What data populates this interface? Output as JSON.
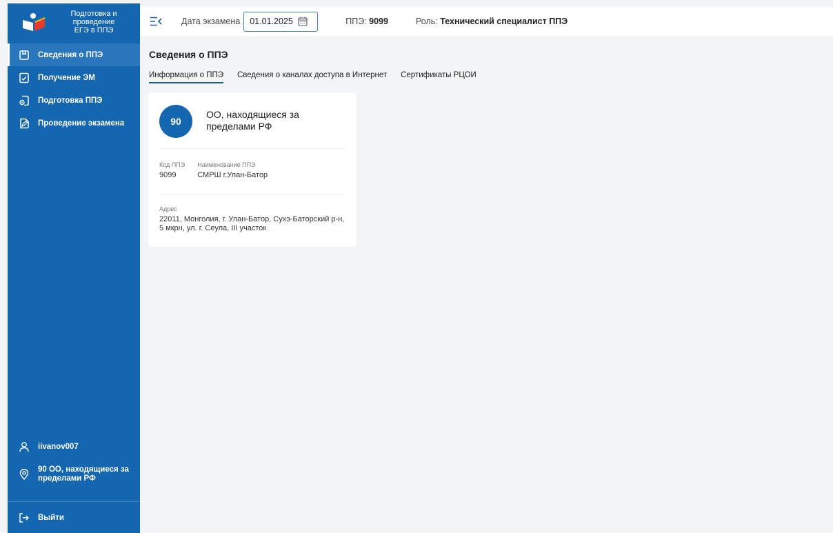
{
  "brand": {
    "title": "Подготовка и проведение ЕГЭ в ППЭ",
    "line1": "Подготовка и",
    "line2": "проведение",
    "line3": "ЕГЭ в ППЭ"
  },
  "nav": {
    "items": [
      {
        "label": "Сведения о ППЭ",
        "icon": "book-icon",
        "active": true
      },
      {
        "label": "Получение ЭМ",
        "icon": "document-receive-icon",
        "active": false
      },
      {
        "label": "Подготовка ППЭ",
        "icon": "document-settings-icon",
        "active": false
      },
      {
        "label": "Проведение экзамена",
        "icon": "document-edit-icon",
        "active": false
      }
    ]
  },
  "user": {
    "login": "iivanov007",
    "icon": "user-icon"
  },
  "ppe_location": {
    "line1": "90 ОО, находящиеся за",
    "line2": "пределами РФ",
    "icon": "location-pin-icon"
  },
  "logout": {
    "label": "Выйти",
    "icon": "logout-icon"
  },
  "topbar": {
    "date_label": "Дата экзамена",
    "date_value": "01.01.2025",
    "ppe_label": "ППЭ:",
    "ppe_value": "9099",
    "role_label": "Роль:",
    "role_value": "Технический специалист ППЭ"
  },
  "page": {
    "title": "Сведения о ППЭ",
    "tabs": [
      {
        "label": "Информация о ППЭ",
        "active": true
      },
      {
        "label": "Сведения о каналах доступа в Интернет",
        "active": false
      },
      {
        "label": "Сертификаты РЦОИ",
        "active": false
      }
    ]
  },
  "card": {
    "badge": "90",
    "title": "ОО, находящиеся за пределами РФ",
    "code_label": "Код ППЭ",
    "code_value": "9099",
    "name_label": "Наименование ППЭ",
    "name_value": "СМРШ г.Улан-Батор",
    "address_label": "Адрес",
    "address_value": "22011, Монголия, г. Улан-Батор, Сухэ-Баторский р-н, 5 мкрн, ул. г. Сеула, III участок"
  },
  "colors": {
    "sidebar": "#1466b0",
    "accent": "#1a5e9c",
    "background": "#f2f4f6"
  }
}
